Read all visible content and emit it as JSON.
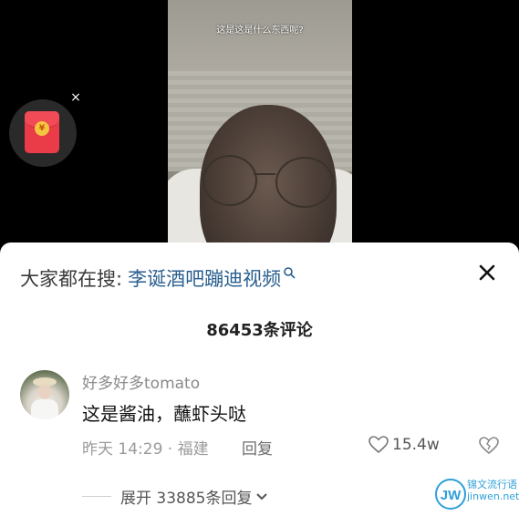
{
  "video": {
    "caption": "这是这是什么东西呢?"
  },
  "red_packet": {
    "close_glyph": "×"
  },
  "search_bar": {
    "prefix": "大家都在搜:",
    "query": "李诞酒吧蹦迪视频"
  },
  "comments": {
    "count_title": "86453条评论",
    "items": [
      {
        "username": "好多好多tomato",
        "text": "这是酱油，蘸虾头哒",
        "time_location": "昨天 14:29 · 福建",
        "reply_label": "回复",
        "likes": "15.4w",
        "expand_label": "展开 33885条回复"
      }
    ]
  },
  "watermark": {
    "line1": "锦文流行语",
    "line2": "jinwen.net",
    "logo_text": "JW"
  },
  "colors": {
    "link": "#2a5f8f",
    "watermark": "#2ea0d8",
    "red_packet": "#ea3b48"
  }
}
